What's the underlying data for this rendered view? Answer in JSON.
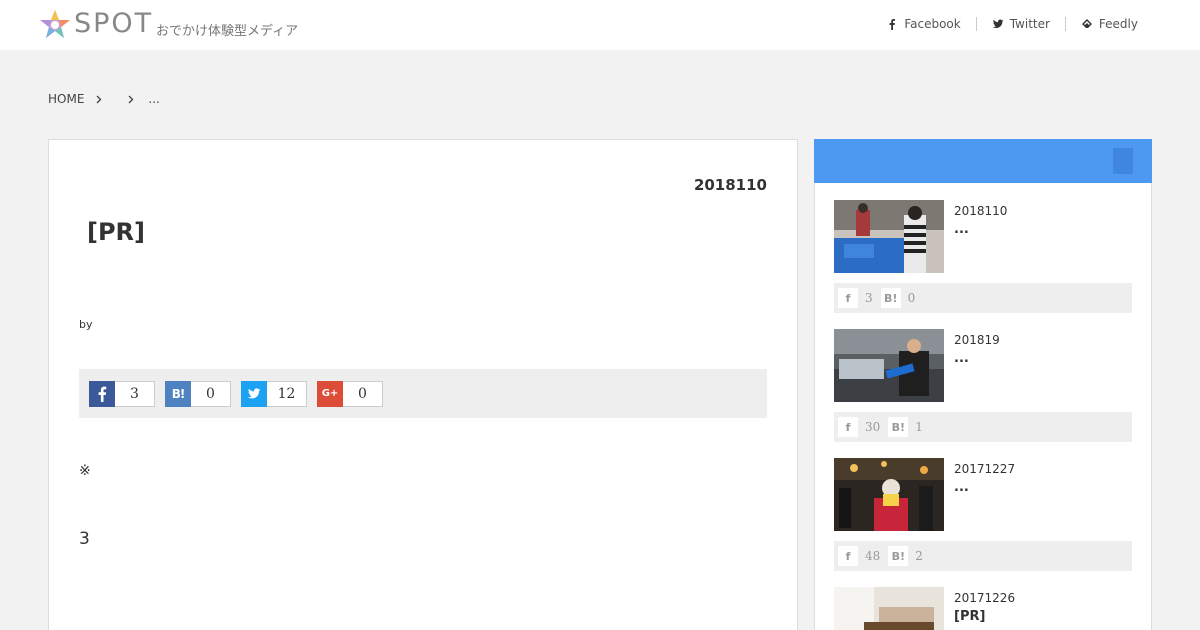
{
  "header": {
    "logo_word": "SPOT",
    "tagline": "おでかけ体験型メディア",
    "links": [
      {
        "label": "Facebook",
        "icon": "facebook-icon"
      },
      {
        "label": "Twitter",
        "icon": "twitter-icon"
      },
      {
        "label": "Feedly",
        "icon": "feedly-icon"
      }
    ]
  },
  "breadcrumb": {
    "home": "HOME",
    "current": "..."
  },
  "article": {
    "date": "2018110",
    "title": "[PR]",
    "by": "by",
    "share": [
      {
        "service": "facebook",
        "glyph": "f",
        "count": "3",
        "color": "#3b5998"
      },
      {
        "service": "hatena",
        "glyph": "B!",
        "count": "0",
        "color": "#4e82c0"
      },
      {
        "service": "twitter",
        "glyph": "t",
        "count": "12",
        "color": "#1da1f2"
      },
      {
        "service": "googleplus",
        "glyph": "G+",
        "count": "0",
        "color": "#dd4b39"
      }
    ],
    "note": "※",
    "number": "3"
  },
  "sidebar": {
    "accent_color": "#4d98f0",
    "posts": [
      {
        "date": "2018110",
        "title": "...",
        "fb_count": "3",
        "hatena_count": "0"
      },
      {
        "date": "201819",
        "title": "...",
        "fb_count": "30",
        "hatena_count": "1"
      },
      {
        "date": "20171227",
        "title": "...",
        "fb_count": "48",
        "hatena_count": "2"
      },
      {
        "date": "20171226",
        "title": "[PR]",
        "fb_count": "",
        "hatena_count": ""
      }
    ]
  }
}
